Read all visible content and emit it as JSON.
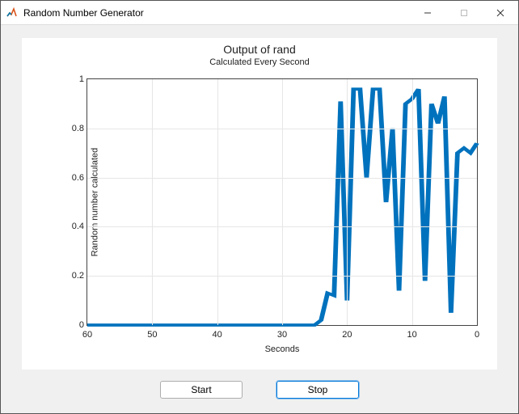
{
  "window": {
    "title": "Random Number Generator"
  },
  "chart_data": {
    "type": "line",
    "title": "Output of rand",
    "subtitle": "Calculated Every Second",
    "xlabel": "Seconds",
    "ylabel": "Random number calculated",
    "xlim": [
      60,
      0
    ],
    "ylim": [
      0,
      1
    ],
    "xticks": [
      60,
      50,
      40,
      30,
      20,
      10,
      0
    ],
    "yticks": [
      0,
      0.2,
      0.4,
      0.6,
      0.8,
      1
    ],
    "x": [
      60,
      59,
      58,
      57,
      56,
      55,
      54,
      53,
      52,
      51,
      50,
      49,
      48,
      47,
      46,
      45,
      44,
      43,
      42,
      41,
      40,
      39,
      38,
      37,
      36,
      35,
      34,
      33,
      32,
      31,
      30,
      29,
      28,
      27,
      26,
      25,
      24,
      23,
      22,
      21,
      20,
      19,
      18,
      17,
      16,
      15,
      14,
      13,
      12,
      11,
      10,
      9,
      8,
      7,
      6,
      5,
      4,
      3,
      2,
      1,
      0
    ],
    "values": [
      0,
      0,
      0,
      0,
      0,
      0,
      0,
      0,
      0,
      0,
      0,
      0,
      0,
      0,
      0,
      0,
      0,
      0,
      0,
      0,
      0,
      0,
      0,
      0,
      0,
      0,
      0,
      0,
      0,
      0,
      0,
      0,
      0,
      0,
      0,
      0,
      0.02,
      0.13,
      0.12,
      0.91,
      0.1,
      0.96,
      0.96,
      0.6,
      0.96,
      0.96,
      0.5,
      0.8,
      0.14,
      0.9,
      0.92,
      0.96,
      0.18,
      0.9,
      0.82,
      0.93,
      0.05,
      0.7,
      0.72,
      0.7,
      0.74
    ]
  },
  "buttons": {
    "start": "Start",
    "stop": "Stop"
  }
}
